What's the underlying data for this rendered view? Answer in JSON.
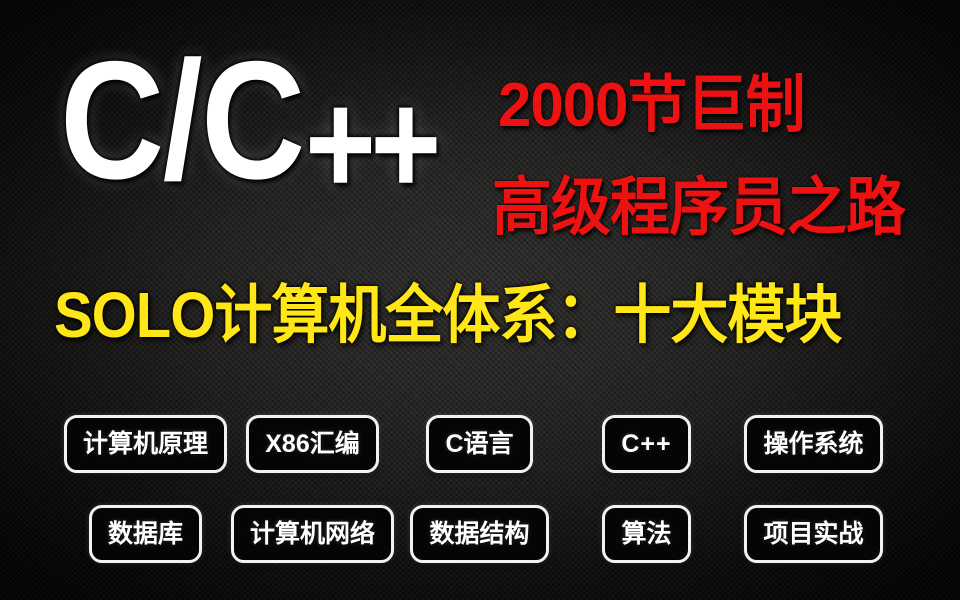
{
  "poster": {
    "background_color": "#1e1d1c",
    "accent_red": "#ee1111",
    "accent_yellow": "#ffe617",
    "accent_white": "#ffffff"
  },
  "logo": {
    "cc_text": "C/C",
    "plus_text": "++",
    "full_text": "C/C++"
  },
  "headline": {
    "red_line_1": "2000节巨制",
    "red_line_2": "高级程序员之路",
    "yellow_title": "SOLO计算机全体系：十大模块"
  },
  "modules": {
    "row1": [
      {
        "label": "计算机原理",
        "script": "cjk"
      },
      {
        "label": "X86汇编",
        "script": "mixed"
      },
      {
        "label": "C语言",
        "script": "mixed"
      },
      {
        "label": "C++",
        "script": "latin"
      },
      {
        "label": "操作系统",
        "script": "cjk"
      }
    ],
    "row2": [
      {
        "label": "数据库",
        "script": "cjk"
      },
      {
        "label": "计算机网络",
        "script": "cjk"
      },
      {
        "label": "数据结构",
        "script": "cjk"
      },
      {
        "label": "算法",
        "script": "cjk"
      },
      {
        "label": "项目实战",
        "script": "cjk"
      }
    ]
  }
}
